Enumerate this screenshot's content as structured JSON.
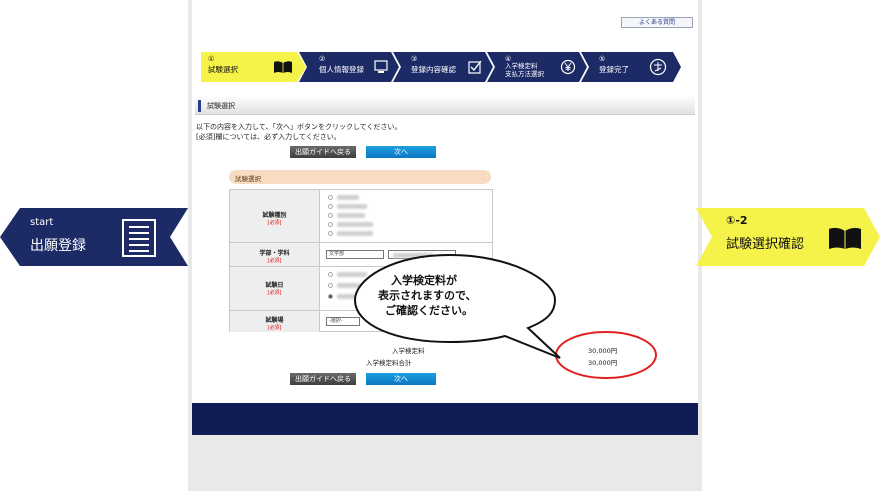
{
  "header": {
    "faq_link": "よくある質問"
  },
  "steps": [
    {
      "num": "①",
      "label": "試験選択",
      "icon": "book-icon",
      "active": true
    },
    {
      "num": "②",
      "label": "個人情報登録",
      "icon": "computer-icon",
      "active": false
    },
    {
      "num": "③",
      "label": "登録内容確認",
      "icon": "checkbox-icon",
      "active": false
    },
    {
      "num": "④",
      "label": "入学検定料\n支払方法選択",
      "icon": "yen-icon",
      "active": false
    },
    {
      "num": "⑤",
      "label": "登録完了",
      "icon": "complete-stamp-icon",
      "active": false
    }
  ],
  "section": {
    "title": "試験選択",
    "intro_line1": "以下の内容を入力して、「次へ」ボタンをクリックしてください。",
    "intro_line2": "[必須]欄については、必ず入力してください。"
  },
  "buttons": {
    "back": "出願ガイドへ戻る",
    "next": "次へ"
  },
  "form": {
    "pill_title": "試験選択",
    "required": "[必須]",
    "rows": [
      {
        "label": "試験種別"
      },
      {
        "label": "学部・学科"
      },
      {
        "label": "試験日"
      },
      {
        "label": "試験場"
      }
    ],
    "dept_select": "文学部",
    "venue_select": "-選択-"
  },
  "fees": {
    "fee_label": "入学検定料",
    "fee_value": "30,000円",
    "total_label": "入学検定料合計",
    "total_value": "30,000円"
  },
  "callout": {
    "line1": "入学検定料が",
    "line2": "表示されますので、",
    "line3": "ご確認ください。"
  },
  "flags": {
    "left_small": "start",
    "left_big": "出願登録",
    "right_small": "①-2",
    "right_big": "試験選択確認"
  },
  "colors": {
    "active_step": "#f5f24a",
    "step_navy": "#1c2a66",
    "flag_left": "#1c2a66",
    "flag_right": "#f5f24a",
    "footer": "#111c55",
    "next_button": "#0b76c2",
    "highlight_circle": "#e02020"
  }
}
